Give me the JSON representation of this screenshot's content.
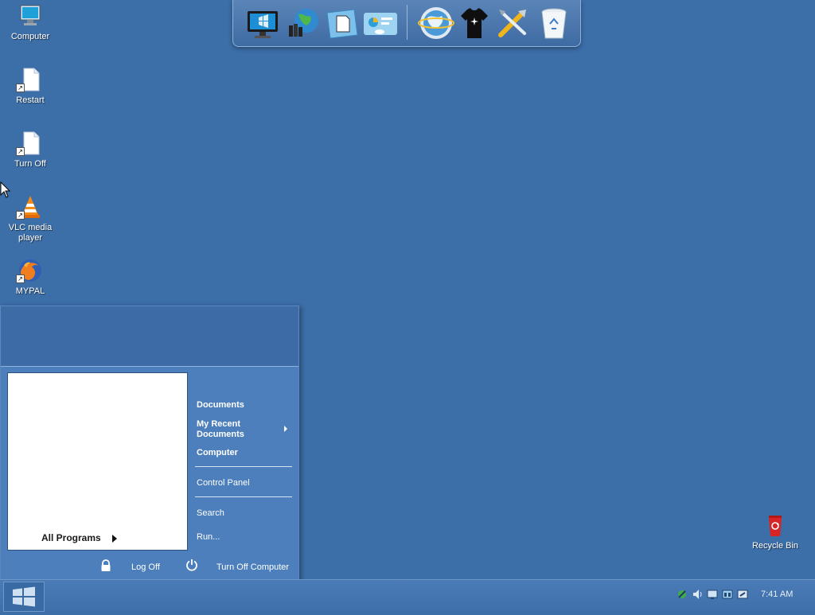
{
  "desktop": {
    "icons": [
      {
        "label": "Computer",
        "icon": "computer-icon"
      },
      {
        "label": "Restart",
        "icon": "document-shortcut-icon"
      },
      {
        "label": "Turn Off",
        "icon": "document-shortcut-icon"
      },
      {
        "label": "VLC media player",
        "icon": "vlc-icon"
      },
      {
        "label": "MYPAL",
        "icon": "firefox-icon"
      },
      {
        "label": "Recycle Bin",
        "icon": "recycle-bin-icon"
      }
    ]
  },
  "dock": {
    "items": [
      "monitor-icon",
      "globe-network-icon",
      "folder-document-icon",
      "control-panel-icon",
      "internet-globe-icon",
      "tshirt-icon",
      "tools-icon",
      "trash-icon"
    ]
  },
  "start_menu": {
    "all_programs": "All Programs",
    "right": {
      "documents": "Documents",
      "recent_documents": "My Recent Documents",
      "computer": "Computer",
      "control_panel": "Control Panel",
      "search": "Search",
      "run": "Run..."
    },
    "footer": {
      "log_off": "Log Off",
      "turn_off": "Turn Off Computer"
    }
  },
  "taskbar": {
    "clock": "7:41 AM",
    "tray_icons": [
      "network-icon",
      "volume-icon",
      "display-icon",
      "keyboard-icon",
      "tools-tray-icon"
    ]
  },
  "colors": {
    "desktop_bg": "#3c6ea8",
    "start_menu_body": "#4c7fbb",
    "taskbar": "#4477b2"
  }
}
